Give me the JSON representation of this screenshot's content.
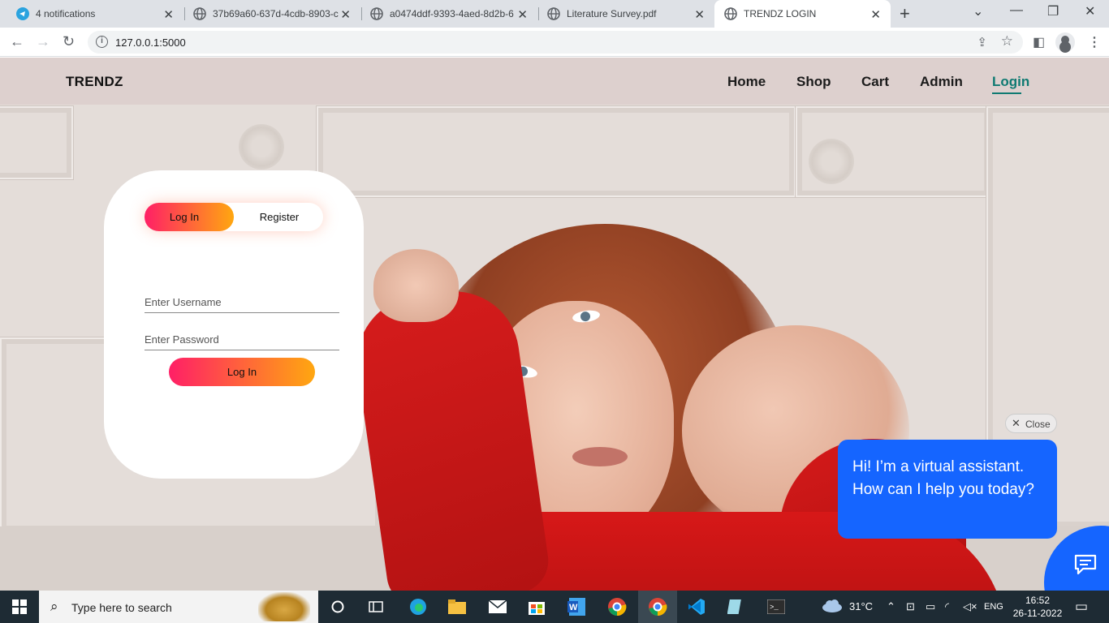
{
  "browser": {
    "tabs": [
      {
        "title": "4 notifications",
        "icon": "telegram-icon",
        "active": false
      },
      {
        "title": "37b69a60-637d-4cdb-8903-c",
        "icon": "globe-icon",
        "active": false
      },
      {
        "title": "a0474ddf-9393-4aed-8d2b-6",
        "icon": "globe-icon",
        "active": false
      },
      {
        "title": "Literature Survey.pdf",
        "icon": "globe-icon",
        "active": false
      },
      {
        "title": "TRENDZ LOGIN",
        "icon": "globe-icon",
        "active": true
      }
    ],
    "url": "127.0.0.1:5000"
  },
  "site": {
    "brand": "TRENDZ",
    "nav": [
      "Home",
      "Shop",
      "Cart",
      "Admin",
      "Login"
    ],
    "active_nav": "Login",
    "accent": "#0f7a72"
  },
  "login": {
    "toggle_login": "Log In",
    "toggle_register": "Register",
    "username_placeholder": "Enter Username",
    "password_placeholder": "Enter Password",
    "submit_label": "Log In",
    "gradient_start": "#ff1f66",
    "gradient_end": "#ffa710"
  },
  "chat": {
    "close_label": "Close",
    "message": "Hi! I’m a virtual assistant. How can I help you today?",
    "color": "#1565ff"
  },
  "taskbar": {
    "search_placeholder": "Type here to search",
    "temperature": "31°C",
    "language": "ENG",
    "time": "16:52",
    "date": "26-11-2022"
  }
}
